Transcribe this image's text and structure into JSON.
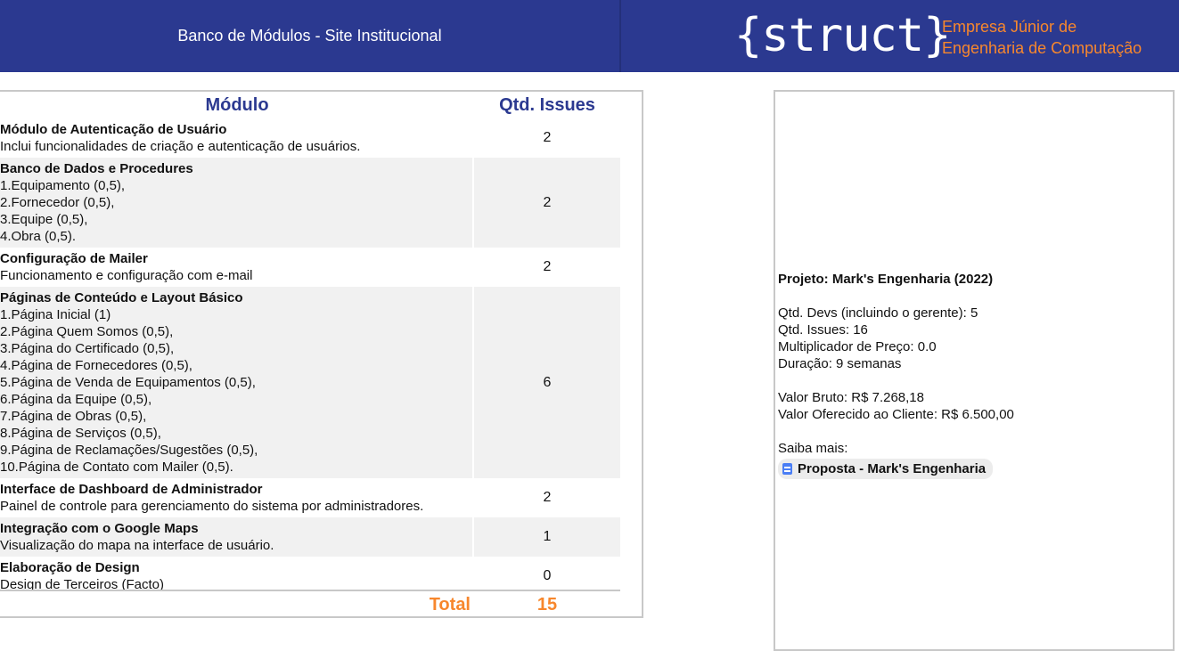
{
  "header": {
    "title": "Banco de Módulos - Site Institucional",
    "logo_text": "{struct}",
    "logo_sub_line1": "Empresa Júnior de",
    "logo_sub_line2": "Engenharia de Computação",
    "brand_color": "#2b3990",
    "accent_color": "#f7872d"
  },
  "table": {
    "col_module": "Módulo",
    "col_issues": "Qtd. Issues",
    "rows": [
      {
        "name": "Módulo de Autenticação de Usuário",
        "lines": [
          "Inclui funcionalidades de criação e autenticação de usuários."
        ],
        "issues": "2"
      },
      {
        "name": "Banco de Dados e Procedures",
        "lines": [
          "1.Equipamento (0,5),",
          "2.Fornecedor (0,5),",
          "3.Equipe (0,5),",
          "4.Obra (0,5)."
        ],
        "issues": "2"
      },
      {
        "name": "Configuração de Mailer",
        "lines": [
          "Funcionamento e configuração com e-mail"
        ],
        "issues": "2"
      },
      {
        "name": "Páginas de Conteúdo e Layout Básico",
        "lines": [
          "1.Página Inicial (1)",
          "2.Página Quem Somos (0,5),",
          "3.Página do Certificado (0,5),",
          "4.Página de Fornecedores (0,5),",
          "5.Página de Venda de Equipamentos (0,5),",
          "6.Página da Equipe (0,5),",
          "7.Página de Obras (0,5),",
          "8.Página de Serviços (0,5),",
          "9.Página de Reclamações/Sugestões (0,5),",
          "10.Página de Contato com Mailer (0,5)."
        ],
        "issues": "6"
      },
      {
        "name": "Interface de Dashboard de Administrador",
        "lines": [
          "Painel de controle para gerenciamento do sistema por administradores."
        ],
        "issues": "2"
      },
      {
        "name": "Integração com o Google Maps",
        "lines": [
          "Visualização do mapa na interface de usuário."
        ],
        "issues": "1"
      },
      {
        "name": "Elaboração de Design",
        "lines": [
          "Design de Terceiros (Facto)"
        ],
        "issues": "0"
      }
    ],
    "total_label": "Total",
    "total_value": "15"
  },
  "project": {
    "title": "Projeto: Mark's Engenharia (2022)",
    "devs": "Qtd. Devs (incluindo o gerente): 5",
    "issues": "Qtd. Issues: 16",
    "multiplier": "Multiplicador de Preço: 0.0",
    "duration": "Duração: 9 semanas",
    "gross_value": "Valor Bruto: R$ 7.268,18",
    "offered_value": "Valor Oferecido ao Cliente: R$ 6.500,00",
    "more_label": "Saiba mais:",
    "doc_link": "Proposta - Mark's Engenharia",
    "doc_icon": "google-docs-icon"
  }
}
